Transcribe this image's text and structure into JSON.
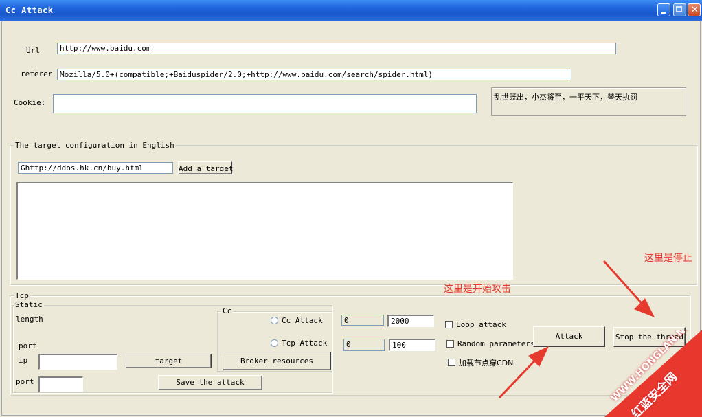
{
  "window": {
    "title": "Cc Attack"
  },
  "form": {
    "url_label": "Url",
    "url_value": "http://www.baidu.com",
    "referer_label": "referer",
    "referer_value": "Mozilla/5.0+(compatible;+Baiduspider/2.0;+http://www.baidu.com/search/spider.html)",
    "cookie_label": "Cookie:",
    "cookie_value": "",
    "slogan": "乱世既出，小杰将至，一平天下，替天执罚"
  },
  "target_group": {
    "legend": "The target configuration in English",
    "target_input_value": "Ghttp://ddos.hk.cn/buy.html",
    "add_button": "Add a target",
    "targets_list": ""
  },
  "tcp_group": {
    "legend": "Tcp",
    "static_legend": "Static",
    "length_label": "length",
    "port_label_top": "port",
    "ip_label": "ip",
    "ip_value": "",
    "target_button": "target",
    "port_label": "port",
    "port_value": "",
    "save_button": "Save the attack"
  },
  "cc_group": {
    "legend": "Cc",
    "cc_attack_radio": "Cc  Attack",
    "tcp_attack_radio": "Tcp  Attack",
    "broker_button": "Broker resources"
  },
  "params": {
    "field1": "0",
    "field2": "2000",
    "field3": "0",
    "field4": "100"
  },
  "options": {
    "loop_attack": "Loop attack",
    "random_params": "Random parameters",
    "cdn_bypass": "加载节点穿CDN"
  },
  "actions": {
    "attack_button": "Attack",
    "stop_button": "Stop the thread"
  },
  "annotations": {
    "start_note": "这里是开始攻击",
    "stop_note": "这里是停止",
    "color": "#e63a2e"
  },
  "watermark": {
    "line1": "WWW.HONGLAN.NET",
    "line2": "红蓝安全网"
  }
}
